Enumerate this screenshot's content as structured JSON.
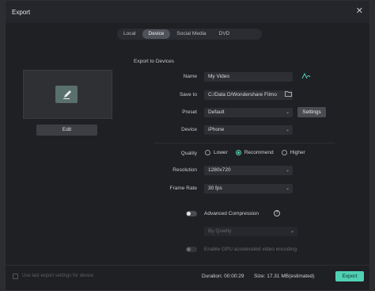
{
  "window": {
    "title": "Export",
    "close_icon": "close-icon"
  },
  "tabs": [
    {
      "label": "Local",
      "active": false
    },
    {
      "label": "Device",
      "active": true
    },
    {
      "label": "Social Media",
      "active": false
    },
    {
      "label": "DVD",
      "active": false
    }
  ],
  "preview": {
    "icon": "pencil-icon",
    "edit_label": "Edit"
  },
  "form": {
    "section_title": "Export to Devices",
    "name_label": "Name",
    "name_value": "My Video",
    "ai_icon": "ai-rename-icon",
    "save_label": "Save to",
    "save_value": "C:/Data D/Wondershare Filmo",
    "folder_icon": "folder-icon",
    "preset_label": "Preset",
    "preset_value": "Default",
    "settings_label": "Settings",
    "device_label": "Device",
    "device_value": "iPhone",
    "quality_label": "Quality",
    "quality_options": [
      "Lower",
      "Recommend",
      "Higher"
    ],
    "quality_selected": "Recommend",
    "resolution_label": "Resolution",
    "resolution_value": "1280x720",
    "framerate_label": "Frame Rate",
    "framerate_value": "30 fps",
    "adv_label": "Advanced Compression",
    "by_quality_value": "By Quality",
    "gpu_label": "Enable GPU accelerated video encoding"
  },
  "footer": {
    "last_settings_label": "Use last export settings for device",
    "duration": "Duration: 00:00:29",
    "size": "Size: 17.31 MB(estimated)",
    "export_label": "Export"
  },
  "colors": {
    "accent": "#4fd0b4",
    "background": "#1f2024"
  }
}
